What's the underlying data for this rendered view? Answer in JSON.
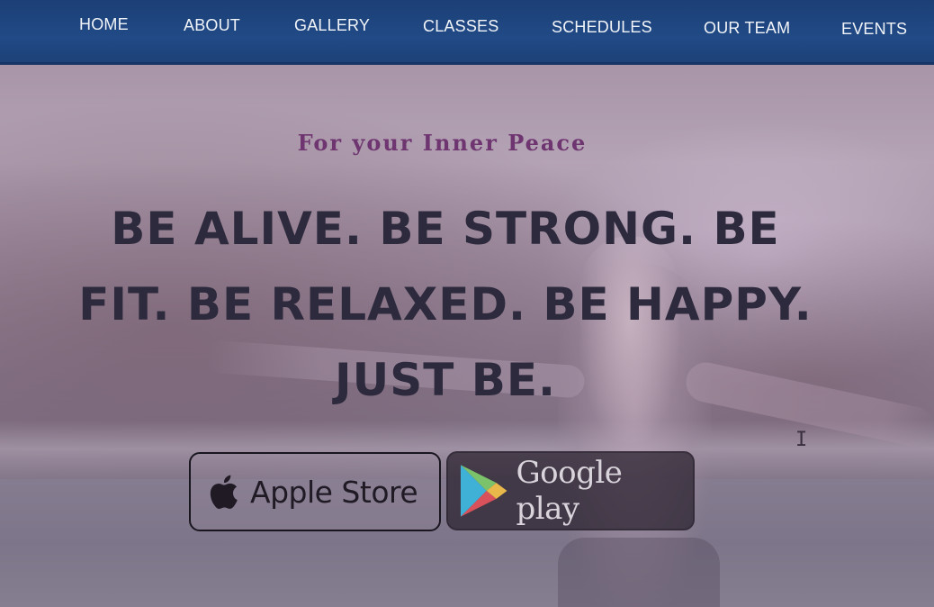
{
  "nav": {
    "items": [
      {
        "label": "HOME"
      },
      {
        "label": "ABOUT"
      },
      {
        "label": "GALLERY"
      },
      {
        "label": "CLASSES"
      },
      {
        "label": "SCHEDULES"
      },
      {
        "label": "OUR TEAM"
      },
      {
        "label": "EVENTS"
      }
    ]
  },
  "hero": {
    "tagline": "For your Inner Peace",
    "headline_lines": [
      "BE ALIVE. BE STRONG. BE",
      "FIT. BE RELAXED. BE HAPPY.",
      "JUST BE."
    ]
  },
  "store_buttons": {
    "apple": {
      "label": "Apple Store",
      "icon": "apple-icon"
    },
    "google": {
      "label": "Google play",
      "icon": "google-play-icon"
    }
  },
  "colors": {
    "nav_bg": "#214a86",
    "nav_text": "#f1f4f8",
    "tagline": "#6e3570",
    "headline": "#2e2a3e"
  }
}
